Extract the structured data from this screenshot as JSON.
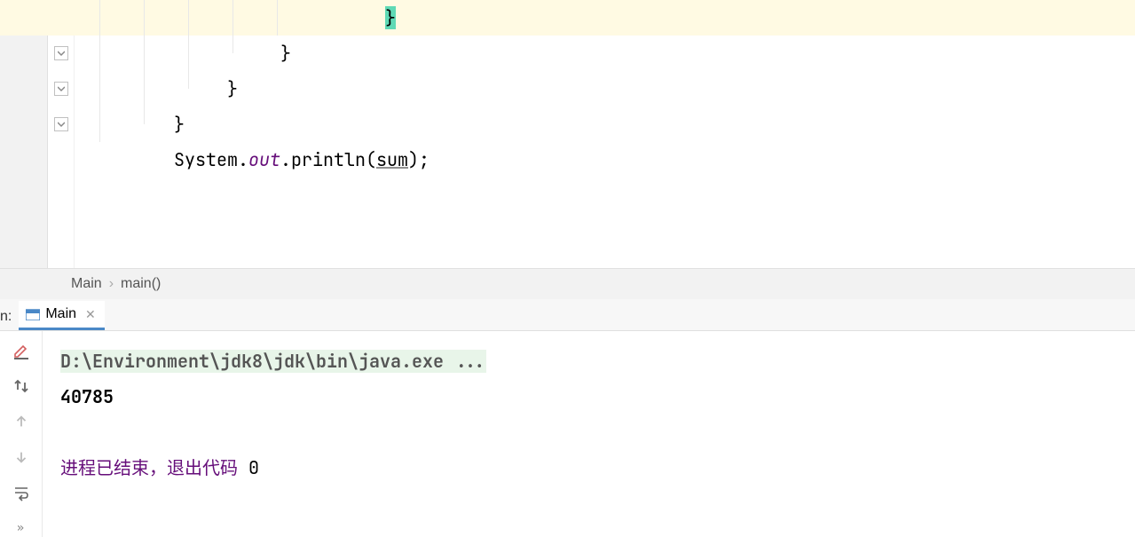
{
  "editor": {
    "lines": [
      {
        "indent": 28,
        "text": "}",
        "highlighted": true,
        "caretBrace": true
      },
      {
        "indent": 20,
        "text": "}",
        "highlighted": false
      },
      {
        "indent": 12,
        "text": "}",
        "highlighted": false
      },
      {
        "indent": 8,
        "text": "}",
        "highlighted": false
      }
    ],
    "printlnLine": {
      "indent": 8,
      "parts": {
        "system": "System",
        "dot1": ".",
        "out": "out",
        "dot2": ".",
        "println": "println",
        "open": "(",
        "arg": "sum",
        "close": ")",
        "semi": ";"
      }
    },
    "foldMarkers": [
      12,
      52,
      92,
      132
    ],
    "indentGuides": [
      28,
      78,
      128,
      178,
      228
    ]
  },
  "breadcrumb": {
    "class": "Main",
    "method": "main()"
  },
  "runTab": {
    "debugPrefix": "n:",
    "label": "Main"
  },
  "console": {
    "command": "D:\\Environment\\jdk8\\jdk\\bin\\java.exe ...",
    "output": "40785",
    "exitMessagePrefix": "进程已结束，退出代码 ",
    "exitCode": "0"
  },
  "icons": {
    "underlinePencil": "underline-pencil-icon",
    "upDown": "up-down-arrows-icon",
    "arrowUp": "arrow-up-icon",
    "arrowDown": "arrow-down-icon",
    "softwrap": "softwrap-icon",
    "more": "more-icon"
  }
}
